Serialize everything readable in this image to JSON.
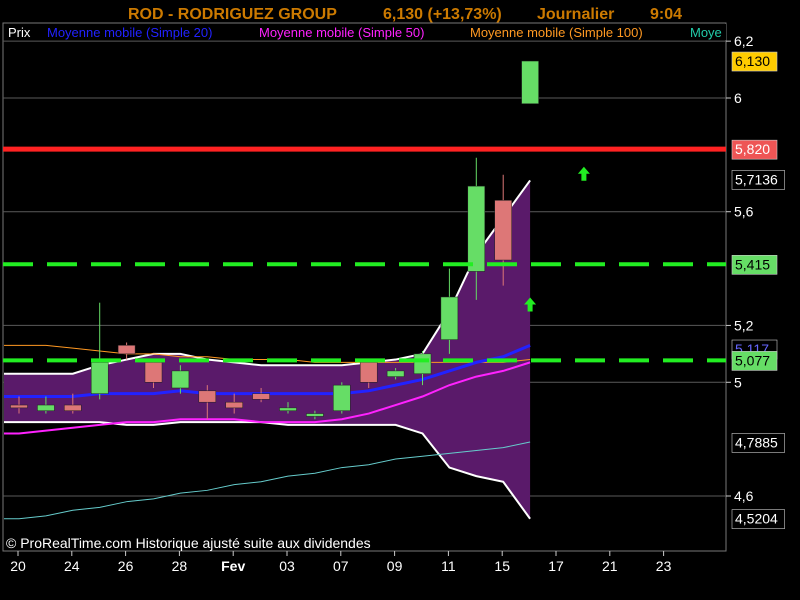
{
  "header": {
    "symbol": "ROD - RODRIGUEZ GROUP",
    "price": "6,130 (+13,73%)",
    "period": "Journalier",
    "time": "9:04"
  },
  "legend": [
    {
      "label": "Prix",
      "color": "#ffffff"
    },
    {
      "label": "Moyenne mobile (Simple 20)",
      "color": "#2222ff"
    },
    {
      "label": "Moyenne mobile (Simple 50)",
      "color": "#ff22ff"
    },
    {
      "label": "Moyenne mobile (Simple 100)",
      "color": "#ff9922"
    },
    {
      "label": "Moye",
      "color": "#22ccaa"
    }
  ],
  "copyright": "© ProRealTime.com Historique ajusté suite aux dividendes",
  "colors": {
    "background": "#000000",
    "grid": "#5a5a5a",
    "up": "#66dd66",
    "down": "#dd7777",
    "red_line": "#ff2222",
    "green_dash": "#22ee22",
    "bollinger_fill": "#5a1a6a",
    "bollinger_band": "#ffffff",
    "sma20": "#2222ff",
    "sma50": "#ff22ff",
    "sma100": "#ff9922",
    "long_ma": "#66cccc",
    "arrow": "#22ee22"
  },
  "chart_data": {
    "type": "candlestick",
    "y_ticks": [
      "6,2",
      "6",
      "5,6",
      "5,2",
      "5",
      "4,6"
    ],
    "x_ticks": [
      "20",
      "24",
      "26",
      "28",
      "Fev",
      "03",
      "07",
      "09",
      "11",
      "15",
      "17",
      "21",
      "23"
    ],
    "y_range": [
      4.42,
      6.25
    ],
    "candles": [
      {
        "o": 4.92,
        "h": 4.95,
        "l": 4.89,
        "c": 4.91
      },
      {
        "o": 4.9,
        "h": 4.95,
        "l": 4.89,
        "c": 4.92
      },
      {
        "o": 4.92,
        "h": 4.96,
        "l": 4.89,
        "c": 4.9
      },
      {
        "o": 4.96,
        "h": 5.28,
        "l": 4.94,
        "c": 5.07
      },
      {
        "o": 5.13,
        "h": 5.14,
        "l": 5.08,
        "c": 5.1
      },
      {
        "o": 5.07,
        "h": 5.08,
        "l": 4.98,
        "c": 5.0
      },
      {
        "o": 4.98,
        "h": 5.06,
        "l": 4.96,
        "c": 5.04
      },
      {
        "o": 4.97,
        "h": 4.99,
        "l": 4.87,
        "c": 4.93
      },
      {
        "o": 4.93,
        "h": 4.96,
        "l": 4.89,
        "c": 4.91
      },
      {
        "o": 4.96,
        "h": 4.98,
        "l": 4.93,
        "c": 4.94
      },
      {
        "o": 4.9,
        "h": 4.93,
        "l": 4.89,
        "c": 4.91
      },
      {
        "o": 4.88,
        "h": 4.9,
        "l": 4.87,
        "c": 4.89
      },
      {
        "o": 4.9,
        "h": 5.0,
        "l": 4.89,
        "c": 4.99
      },
      {
        "o": 5.07,
        "h": 5.08,
        "l": 4.98,
        "c": 5.0
      },
      {
        "o": 5.02,
        "h": 5.05,
        "l": 5.01,
        "c": 5.04
      },
      {
        "o": 5.03,
        "h": 5.11,
        "l": 4.99,
        "c": 5.1
      },
      {
        "o": 5.15,
        "h": 5.4,
        "l": 5.1,
        "c": 5.3
      },
      {
        "o": 5.39,
        "h": 5.79,
        "l": 5.29,
        "c": 5.69
      },
      {
        "o": 5.64,
        "h": 5.73,
        "l": 5.34,
        "c": 5.43
      },
      {
        "o": 5.98,
        "h": 6.13,
        "l": 5.98,
        "c": 6.13
      }
    ],
    "sma20": [
      4.95,
      4.95,
      4.95,
      4.96,
      4.96,
      4.96,
      4.97,
      4.96,
      4.96,
      4.96,
      4.96,
      4.96,
      4.96,
      4.97,
      4.99,
      5.01,
      5.04,
      5.07,
      5.09,
      5.13
    ],
    "sma50": [
      4.82,
      4.83,
      4.84,
      4.85,
      4.86,
      4.86,
      4.87,
      4.87,
      4.87,
      4.86,
      4.86,
      4.86,
      4.87,
      4.89,
      4.92,
      4.95,
      4.99,
      5.02,
      5.04,
      5.07
    ],
    "sma100": [
      5.13,
      5.13,
      5.12,
      5.11,
      5.1,
      5.1,
      5.09,
      5.09,
      5.08,
      5.08,
      5.08,
      5.07,
      5.07,
      5.07,
      5.07,
      5.07,
      5.07,
      5.07,
      5.07,
      5.08
    ],
    "long_ma": [
      4.52,
      4.53,
      4.55,
      4.56,
      4.58,
      4.59,
      4.61,
      4.62,
      4.64,
      4.65,
      4.67,
      4.68,
      4.7,
      4.71,
      4.73,
      4.74,
      4.75,
      4.76,
      4.77,
      4.79
    ],
    "boll_upper": [
      5.03,
      5.03,
      5.03,
      5.06,
      5.08,
      5.1,
      5.1,
      5.08,
      5.07,
      5.06,
      5.06,
      5.06,
      5.06,
      5.07,
      5.08,
      5.1,
      5.25,
      5.45,
      5.58,
      5.71
    ],
    "boll_lower": [
      4.86,
      4.86,
      4.86,
      4.86,
      4.85,
      4.85,
      4.86,
      4.86,
      4.86,
      4.86,
      4.85,
      4.85,
      4.85,
      4.85,
      4.85,
      4.82,
      4.7,
      4.67,
      4.65,
      4.52
    ],
    "hlines": [
      {
        "value": 5.82,
        "label": "5,820",
        "style": "solid",
        "color": "#ff2222"
      },
      {
        "value": 5.415,
        "label": "5,415",
        "style": "dashed",
        "color": "#22ee22"
      },
      {
        "value": 5.077,
        "label": "5,077",
        "style": "dashed",
        "color": "#22ee22"
      }
    ],
    "price_labels": [
      {
        "value": 6.13,
        "label": "6,130",
        "bg": "#ffcc00",
        "fg": "#000000"
      },
      {
        "value": 5.82,
        "label": "5,820",
        "bg": "#ee5555",
        "fg": "#ffffff"
      },
      {
        "value": 5.7136,
        "label": "5,7136",
        "bg": "#000000",
        "fg": "#ffffff"
      },
      {
        "value": 5.415,
        "label": "5,415",
        "bg": "#66dd66",
        "fg": "#000000"
      },
      {
        "value": 5.117,
        "label": "5,117",
        "bg": "#000000",
        "fg": "#6666ff"
      },
      {
        "value": 5.077,
        "label": "5,077",
        "bg": "#66dd66",
        "fg": "#000000"
      },
      {
        "value": 4.7885,
        "label": "4,7885",
        "bg": "#000000",
        "fg": "#ffffff"
      },
      {
        "value": 4.5204,
        "label": "4,5204",
        "bg": "#000000",
        "fg": "#ffffff"
      }
    ],
    "arrows": [
      {
        "bar": 19,
        "value": 5.27
      },
      {
        "bar": 21,
        "value": 5.73
      }
    ]
  }
}
